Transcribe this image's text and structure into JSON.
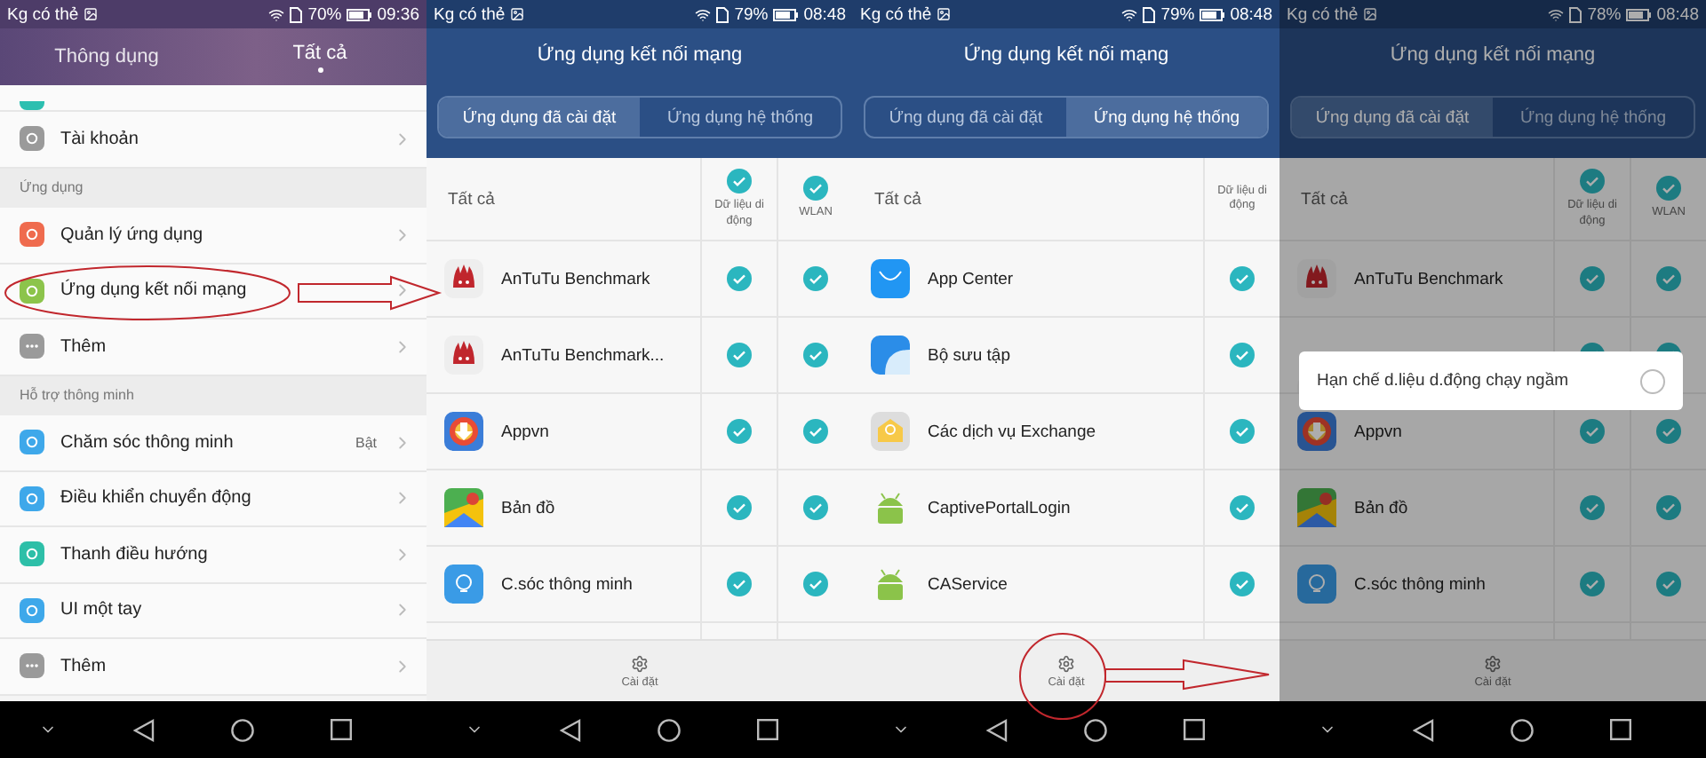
{
  "screens": [
    {
      "kind": "settings",
      "status": {
        "carrier": "Kg có thẻ",
        "battery": "70%",
        "time": "09:36"
      },
      "tabs": [
        {
          "label": "Thông dụng",
          "selected": false
        },
        {
          "label": "Tất cả",
          "selected": true
        }
      ],
      "items": [
        {
          "kind": "clipped"
        },
        {
          "kind": "row",
          "label": "Tài khoản",
          "circled": false
        },
        {
          "kind": "section",
          "label": "Ứng dụng"
        },
        {
          "kind": "row",
          "label": "Quản lý ứng dụng",
          "circled": false
        },
        {
          "kind": "row",
          "label": "Ứng dụng kết nối mạng",
          "circled": true
        },
        {
          "kind": "row",
          "label": "Thêm",
          "circled": false
        },
        {
          "kind": "section",
          "label": "Hỗ trợ thông minh"
        },
        {
          "kind": "row",
          "label": "Chăm sóc thông minh",
          "value": "Bật",
          "circled": false
        },
        {
          "kind": "row",
          "label": "Điều khiển chuyển động",
          "circled": false
        },
        {
          "kind": "row",
          "label": "Thanh điều hướng",
          "circled": false
        },
        {
          "kind": "row",
          "label": "UI một tay",
          "circled": false
        },
        {
          "kind": "row",
          "label": "Thêm",
          "circled": false
        }
      ]
    },
    {
      "kind": "network",
      "status": {
        "carrier": "Kg có thẻ",
        "battery": "79%",
        "time": "08:48"
      },
      "title": "Ứng dụng kết nối mạng",
      "segments": [
        {
          "label": "Ứng dụng đã cài đặt",
          "selected": true
        },
        {
          "label": "Ứng dụng hệ thống",
          "selected": false
        }
      ],
      "all_label": "Tất cả",
      "columns": [
        {
          "label": "Dữ liệu di động",
          "checked": true
        },
        {
          "label": "WLAN",
          "checked": true
        }
      ],
      "apps": [
        {
          "name": "AnTuTu Benchmark",
          "checks": [
            true,
            true
          ]
        },
        {
          "name": "AnTuTu Benchmark...",
          "checks": [
            true,
            true
          ]
        },
        {
          "name": "Appvn",
          "checks": [
            true,
            true
          ]
        },
        {
          "name": "Bản đồ",
          "checks": [
            true,
            true
          ]
        },
        {
          "name": "C.sóc thông minh",
          "checks": [
            true,
            true
          ]
        }
      ],
      "footer": {
        "label": "Cài đặt",
        "circled": false
      }
    },
    {
      "kind": "network",
      "status": {
        "carrier": "Kg có thẻ",
        "battery": "79%",
        "time": "08:48"
      },
      "title": "Ứng dụng kết nối mạng",
      "segments": [
        {
          "label": "Ứng dụng đã cài đặt",
          "selected": false
        },
        {
          "label": "Ứng dụng hệ thống",
          "selected": true
        }
      ],
      "all_label": "Tất cả",
      "columns": [
        {
          "label": "Dữ liệu di động",
          "checked": false
        }
      ],
      "apps": [
        {
          "name": "App Center",
          "checks": [
            true
          ]
        },
        {
          "name": "Bộ sưu tập",
          "checks": [
            true
          ]
        },
        {
          "name": "Các dịch vụ Exchange",
          "checks": [
            true
          ]
        },
        {
          "name": "CaptivePortalLogin",
          "checks": [
            true
          ]
        },
        {
          "name": "CAService",
          "checks": [
            true
          ]
        }
      ],
      "footer": {
        "label": "Cài đặt",
        "circled": true
      }
    },
    {
      "kind": "network",
      "dimmed": true,
      "status": {
        "carrier": "Kg có thẻ",
        "battery": "78%",
        "time": "08:48"
      },
      "title": "Ứng dụng kết nối mạng",
      "segments": [
        {
          "label": "Ứng dụng đã cài đặt",
          "selected": true
        },
        {
          "label": "Ứng dụng hệ thống",
          "selected": false
        }
      ],
      "all_label": "Tất cả",
      "columns": [
        {
          "label": "Dữ liệu di động",
          "checked": true
        },
        {
          "label": "WLAN",
          "checked": true
        }
      ],
      "apps": [
        {
          "name": "AnTuTu Benchmark",
          "checks": [
            true,
            true
          ]
        },
        {
          "checks": [
            true,
            true
          ]
        },
        {
          "name": "Appvn",
          "checks": [
            true,
            true
          ]
        },
        {
          "name": "Bản đồ",
          "checks": [
            true,
            true
          ]
        },
        {
          "name": "C.sóc thông minh",
          "checks": [
            true,
            true
          ]
        }
      ],
      "dialog": {
        "label": "Hạn chế d.liệu d.động chạy ngầm",
        "checked": false
      },
      "footer": {
        "label": "Cài đặt",
        "circled": false
      }
    }
  ]
}
